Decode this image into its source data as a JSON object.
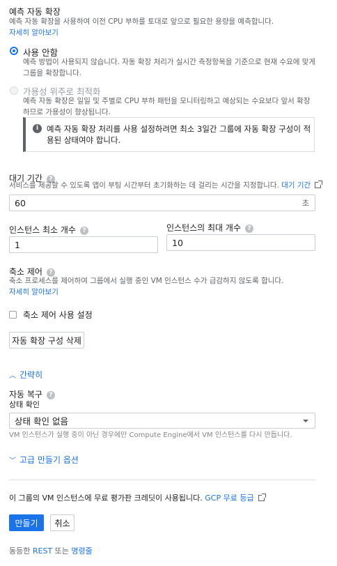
{
  "predictive": {
    "title": "예측 자동 확장",
    "desc": "예측 자동 확장을 사용하여 이전 CPU 부하를 토대로 앞으로 필요한 용량을 예측합니다.",
    "learn_more": "자세히 알아보기",
    "option_off": {
      "label": "사용 안함",
      "desc": "예측 방법이 사용되지 않습니다. 자동 확장 처리가 실시간 측정항목을 기준으로 현재 수요에 맞게 그룹을 확장합니다."
    },
    "option_opt": {
      "label": "가용성 위주로 최적화",
      "desc": "예측 자동 확장은 일일 및 주별로 CPU 부하 패턴을 모니터링하고 예상되는 수요보다 앞서 확장하므로 가용성이 향상됩니다."
    },
    "info": "예측 자동 확장 처리를 사용 설정하려면 최소 3일간 그룹에 자동 확장 구성이 적용된 상태여야 합니다."
  },
  "cooldown": {
    "title": "대기 기간",
    "desc": "서비스를 제공할 수 있도록 앱이 부팅 시간부터 초기화하는 데 걸리는 시간을 지정합니다.",
    "link": "대기 기간",
    "value": "60",
    "unit": "초"
  },
  "instances": {
    "min_label": "인스턴스 최소 개수",
    "min_value": "1",
    "max_label": "인스턴스의 최대 개수",
    "max_value": "10"
  },
  "scalein": {
    "title": "축소 제어",
    "desc": "축소 프로세스를 제어하여 그룹에서 실행 중인 VM 인스턴스 수가 급감하지 않도록 합니다.",
    "learn_more": "자세히 알아보기",
    "checkbox_label": "축소 제어 사용 설정",
    "delete_button": "자동 확장 구성 삭제"
  },
  "collapse": "간략히",
  "autoheal": {
    "title": "자동 복구",
    "health_label": "상태 확인",
    "health_value": "상태 확인 없음",
    "desc": "VM 인스턴스가 실행 중이 아닌 경우에만 Compute Engine에서 VM 인스턴스를 다시 만듭니다."
  },
  "advanced": "고급 만들기 옵션",
  "credit": {
    "text": "이 그룹의 VM 인스턴스에 무료 평가판 크레딧이 사용됩니다.",
    "link": "GCP 무료 등급"
  },
  "actions": {
    "create": "만들기",
    "cancel": "취소"
  },
  "footer": {
    "prefix": "동등한",
    "rest": "REST",
    "mid": "또는",
    "cmd": "명령줄"
  },
  "colors": {
    "accent": "#1a73e8",
    "info_bar": "#5f6368"
  }
}
